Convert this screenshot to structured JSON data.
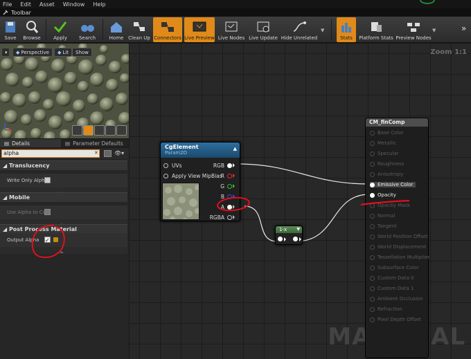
{
  "menu": [
    "File",
    "Edit",
    "Asset",
    "Window",
    "Help"
  ],
  "tab": {
    "label": "Toolbar"
  },
  "toolbar": {
    "buttons": [
      "Save",
      "Browse",
      "Apply",
      "Search",
      "Home",
      "Clean Up",
      "Connectors",
      "Live Preview",
      "Live Nodes",
      "Live Update",
      "Hide Unrelated",
      "Stats",
      "Platform Stats",
      "Preview Nodes"
    ]
  },
  "viewport": {
    "buttons": [
      "Perspective",
      "Lit",
      "Show"
    ]
  },
  "details": {
    "tabs": [
      "Details",
      "Parameter Defaults"
    ],
    "search_value": "alpha",
    "categories": [
      {
        "title": "Translucency",
        "property": "Write Only Alpha"
      },
      {
        "title": "Mobile",
        "property": "Use Alpha to Cov"
      },
      {
        "title": "Post Process Material",
        "property": "Output Alpha"
      }
    ]
  },
  "graph": {
    "zoom": "Zoom 1:1",
    "watermark": "MATERIAL",
    "cg_node": {
      "title": "CgElement",
      "subtitle": "Param2D",
      "inputs": [
        "UVs",
        "Apply View MipBias"
      ],
      "outputs": [
        "RGB",
        "R",
        "G",
        "B",
        "A",
        "RGBA"
      ]
    },
    "oneminus_node": {
      "title": "1-x"
    },
    "material_node": {
      "title": "CM_finComp",
      "inputs": [
        "Base Color",
        "Metallic",
        "Specular",
        "Roughness",
        "Anisotropy",
        "Emissive Color",
        "Opacity",
        "Opacity Mask",
        "Normal",
        "Tangent",
        "World Position Offset",
        "World Displacement",
        "Tessellation Multiplier",
        "Subsurface Color",
        "Custom Data 0",
        "Custom Data 1",
        "Ambient Occlusion",
        "Refraction",
        "Pixel Depth Offset"
      ]
    }
  },
  "colors": {
    "accent": "#e08a19",
    "annotation": "#e0101e",
    "node_header": "#2e6e9e"
  }
}
